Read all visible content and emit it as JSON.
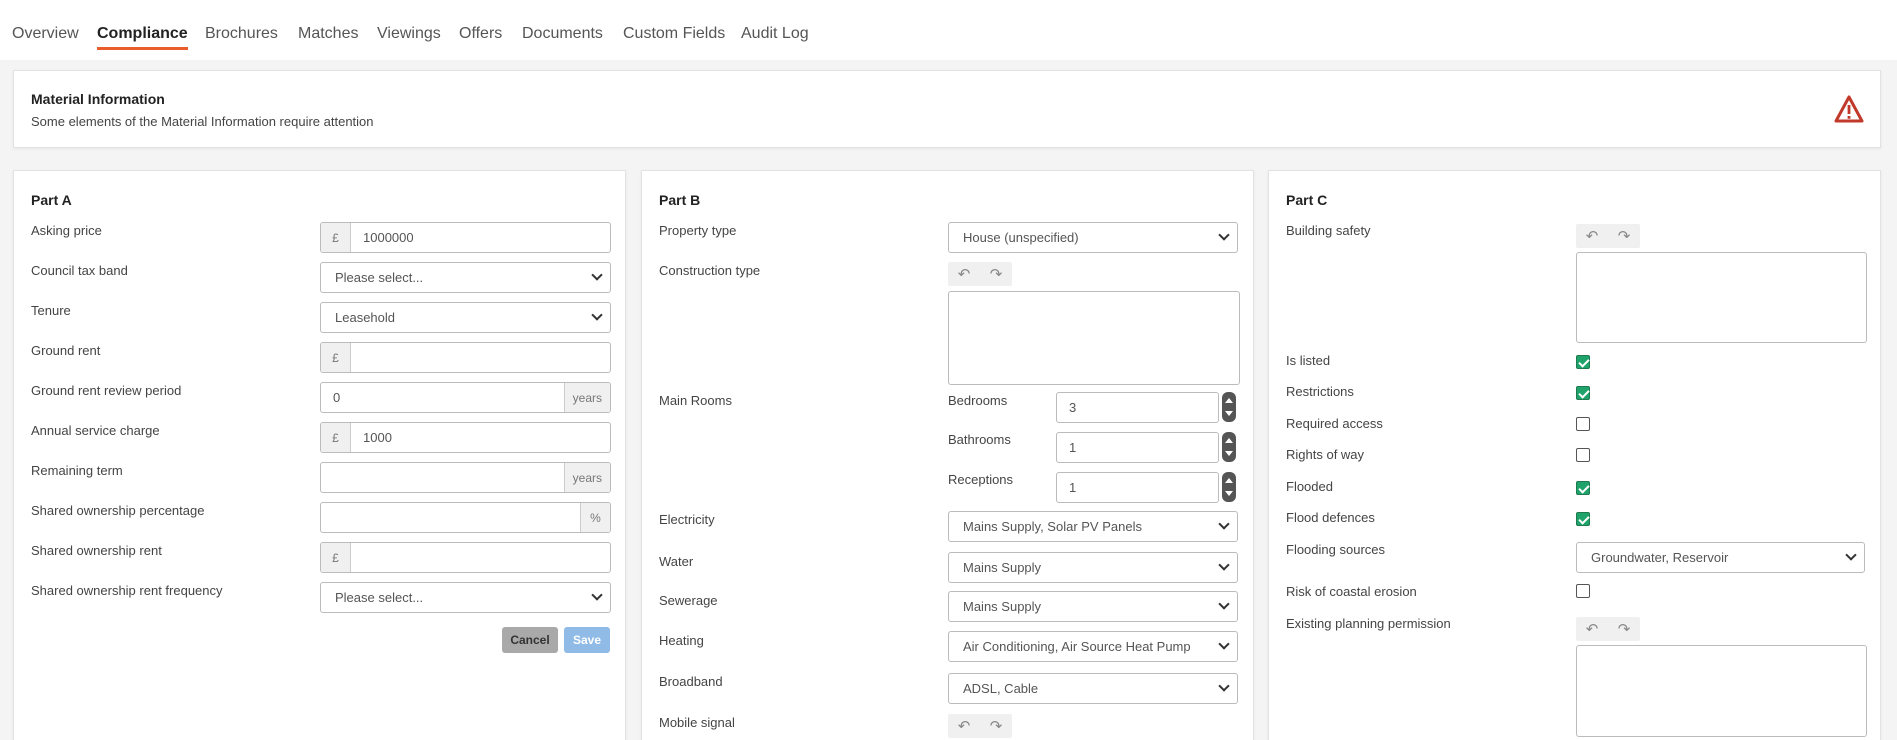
{
  "tabs": [
    "Overview",
    "Compliance",
    "Brochures",
    "Matches",
    "Viewings",
    "Offers",
    "Documents",
    "Custom Fields",
    "Audit Log"
  ],
  "active_tab": "Compliance",
  "alert": {
    "title": "Material Information",
    "text": "Some elements of the Material Information require attention",
    "icon": "warning-triangle-icon",
    "color": "#c0392b"
  },
  "partA": {
    "title": "Part A",
    "labels": {
      "asking_price": "Asking price",
      "council_tax_band": "Council tax band",
      "tenure": "Tenure",
      "ground_rent": "Ground rent",
      "ground_rent_review_period": "Ground rent review period",
      "annual_service_charge": "Annual service charge",
      "remaining_term": "Remaining term",
      "shared_ownership_percentage": "Shared ownership percentage",
      "shared_ownership_rent": "Shared ownership rent",
      "shared_ownership_rent_frequency": "Shared ownership rent frequency"
    },
    "values": {
      "currency_symbol": "£",
      "asking_price": "1000000",
      "council_tax_band": "Please select...",
      "tenure": "Leasehold",
      "ground_rent": "",
      "ground_rent_review_period": "0",
      "years_unit": "years",
      "annual_service_charge": "1000",
      "remaining_term": "",
      "percent_unit": "%",
      "shared_ownership_percentage": "",
      "shared_ownership_rent": "",
      "shared_ownership_rent_frequency": "Please select..."
    },
    "buttons": {
      "cancel": "Cancel",
      "save": "Save"
    }
  },
  "partB": {
    "title": "Part B",
    "labels": {
      "property_type": "Property type",
      "construction_type": "Construction type",
      "main_rooms": "Main Rooms",
      "bedrooms": "Bedrooms",
      "bathrooms": "Bathrooms",
      "receptions": "Receptions",
      "electricity": "Electricity",
      "water": "Water",
      "sewerage": "Sewerage",
      "heating": "Heating",
      "broadband": "Broadband",
      "mobile_signal": "Mobile signal"
    },
    "values": {
      "property_type": "House (unspecified)",
      "bedrooms": "3",
      "bathrooms": "1",
      "receptions": "1",
      "electricity": "Mains Supply, Solar PV Panels",
      "water": "Mains Supply",
      "sewerage": "Mains Supply",
      "heating": "Air Conditioning, Air Source Heat Pump",
      "broadband": "ADSL, Cable"
    },
    "undo_icon": "undo-icon",
    "redo_icon": "redo-icon"
  },
  "partC": {
    "title": "Part C",
    "labels": {
      "building_safety": "Building safety",
      "is_listed": "Is listed",
      "restrictions": "Restrictions",
      "required_access": "Required access",
      "rights_of_way": "Rights of way",
      "flooded": "Flooded",
      "flood_defences": "Flood defences",
      "flooding_sources": "Flooding sources",
      "risk_of_coastal_erosion": "Risk of coastal erosion",
      "existing_planning_permission": "Existing planning permission"
    },
    "checks": {
      "is_listed": true,
      "restrictions": true,
      "required_access": false,
      "rights_of_way": false,
      "flooded": true,
      "flood_defences": true,
      "risk_of_coastal_erosion": false
    },
    "values": {
      "flooding_sources": "Groundwater, Reservoir"
    }
  },
  "colors": {
    "accent": "#e85d2a",
    "checkbox": "#1fa36a",
    "save_button": "#8fbbe6",
    "cancel_button": "#a9a9a9"
  }
}
